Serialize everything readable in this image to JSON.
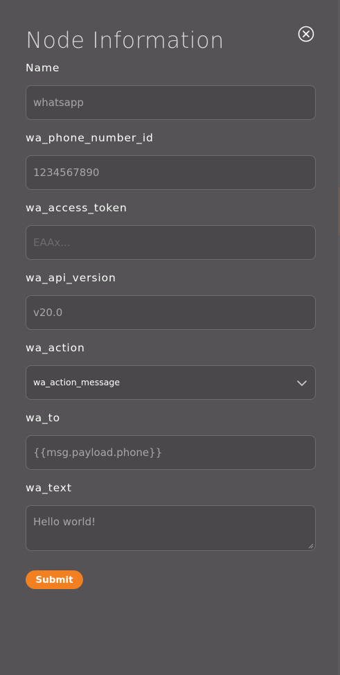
{
  "dialog": {
    "title": "Node Information",
    "close_icon": "close-circle-icon"
  },
  "fields": [
    {
      "label": "Name",
      "value": "whatsapp",
      "placeholder": ""
    },
    {
      "label": "wa_phone_number_id",
      "value": "1234567890",
      "placeholder": ""
    },
    {
      "label": "wa_access_token",
      "value": "",
      "placeholder": "EAAx..."
    },
    {
      "label": "wa_api_version",
      "value": "v20.0",
      "placeholder": ""
    },
    {
      "label": "wa_action",
      "value": "wa_action_message",
      "type": "select",
      "icon": "chevron-down-icon"
    },
    {
      "label": "wa_to",
      "value": "{{msg.payload.phone}}",
      "placeholder": ""
    },
    {
      "label": "wa_text",
      "value": "Hello world!",
      "type": "textarea"
    }
  ],
  "submit_label": "Submit",
  "colors": {
    "background": "#555355",
    "input_background": "#4a484a",
    "input_border": "#6e6c6e",
    "accent": "#f27f20"
  }
}
